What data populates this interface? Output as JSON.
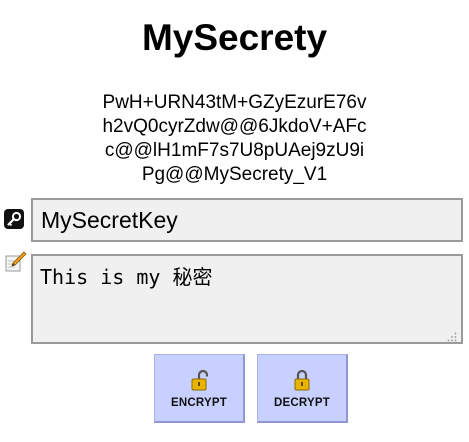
{
  "app": {
    "title": "MySecrety"
  },
  "cipher_lines": [
    "PwH+URN43tM+GZyEzurE76v",
    "h2vQ0cyrZdw@@6JkdoV+AFc",
    "c@@lH1mF7s7U8pUAej9zU9i",
    "Pg@@MySecrety_V1"
  ],
  "key_field": {
    "value": "MySecretKey",
    "icon": "key-icon"
  },
  "message_field": {
    "value": "This is my 秘密",
    "icon": "pencil-icon"
  },
  "buttons": {
    "encrypt": {
      "label": "ENCRYPT",
      "icon": "unlocked-padlock-icon"
    },
    "decrypt": {
      "label": "DECRYPT",
      "icon": "locked-padlock-icon"
    }
  },
  "colors": {
    "button_bg": "#c8d0ff",
    "field_bg": "#f0f0f0",
    "field_border": "#9a9a9a",
    "lock_gold": "#e8b400"
  }
}
